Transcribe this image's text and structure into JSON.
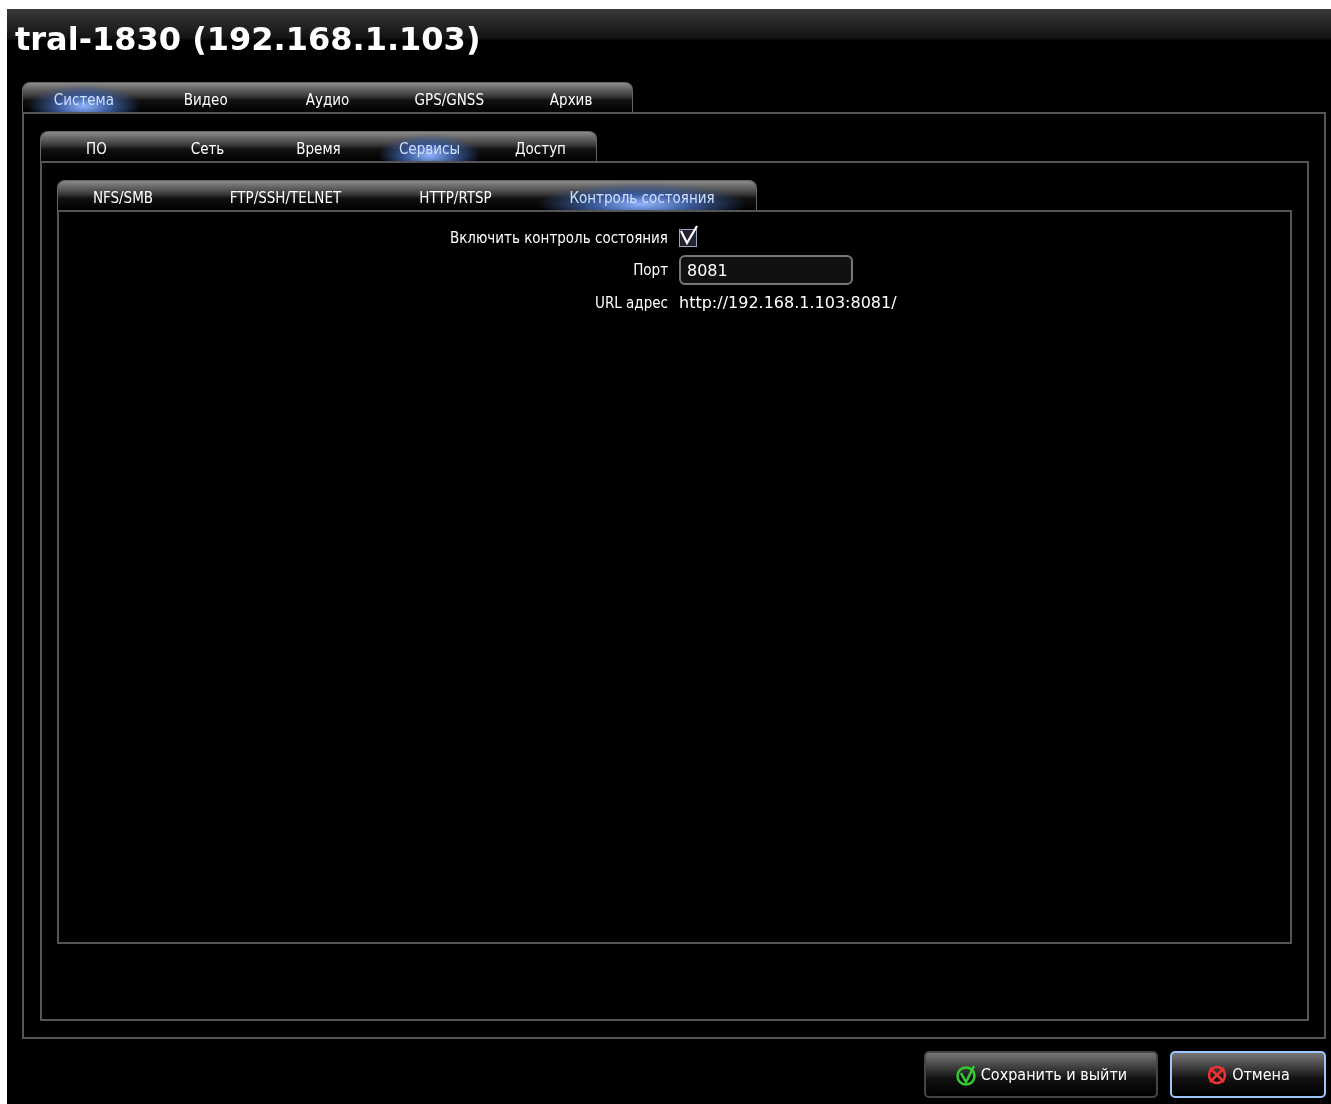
{
  "window": {
    "title": "tral-1830 (192.168.1.103)"
  },
  "tabs": [
    {
      "label": "Система",
      "selected": true
    },
    {
      "label": "Видео",
      "selected": false
    },
    {
      "label": "Аудио",
      "selected": false
    },
    {
      "label": "GPS/GNSS",
      "selected": false
    },
    {
      "label": "Архив",
      "selected": false
    }
  ],
  "subtabs": [
    {
      "label": "ПО",
      "selected": false
    },
    {
      "label": "Сеть",
      "selected": false
    },
    {
      "label": "Время",
      "selected": false
    },
    {
      "label": "Сервисы",
      "selected": true
    },
    {
      "label": "Доступ",
      "selected": false
    }
  ],
  "service_tabs": [
    {
      "label": "NFS/SMB",
      "selected": false
    },
    {
      "label": "FTP/SSH/TELNET",
      "selected": false
    },
    {
      "label": "HTTP/RTSP",
      "selected": false
    },
    {
      "label": "Контроль состояния",
      "selected": true
    }
  ],
  "form": [
    {
      "kind": "checkbox",
      "label": "Включить контроль состояния",
      "checked": true
    },
    {
      "kind": "field",
      "label": "Порт",
      "value": "8081"
    },
    {
      "kind": "text",
      "label": "URL адрес",
      "value": "http://192.168.1.103:8081/"
    }
  ],
  "buttons": [
    {
      "kind": "save",
      "label": "Сохранить и выйти",
      "focused": false
    },
    {
      "kind": "cancel",
      "label": "Отмена",
      "focused": true
    }
  ]
}
